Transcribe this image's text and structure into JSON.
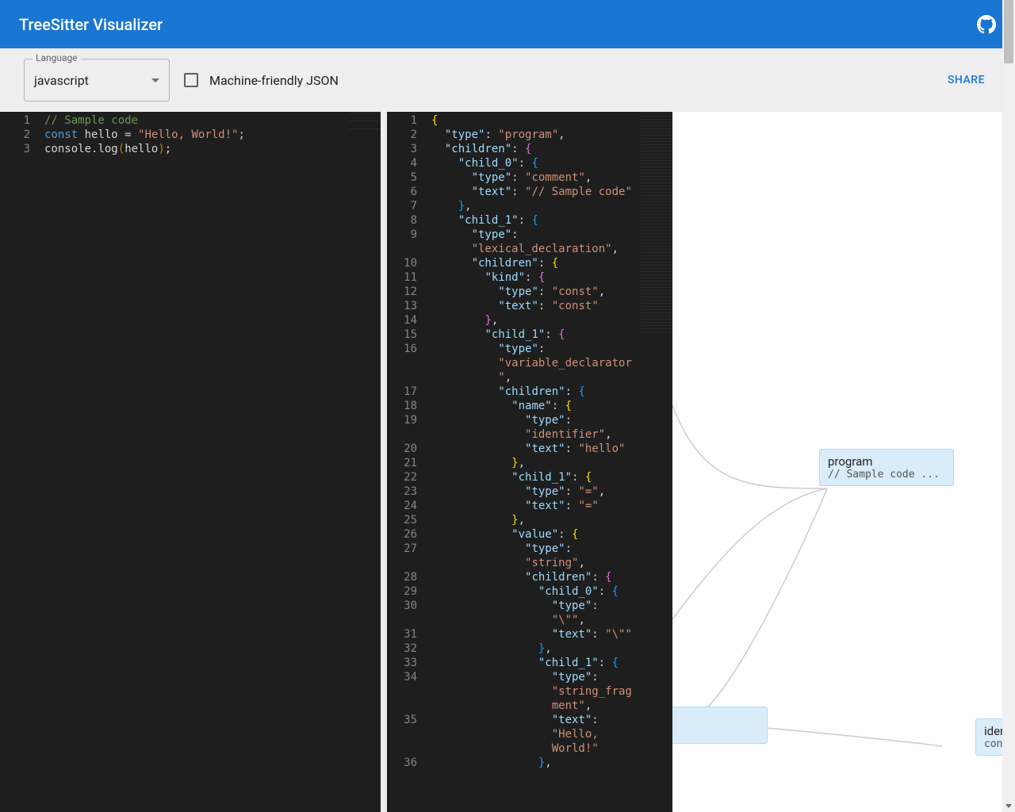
{
  "header": {
    "title": "TreeSitter Visualizer"
  },
  "toolbar": {
    "language_label": "Language",
    "language_value": "javascript",
    "checkbox_label": "Machine-friendly JSON",
    "share_label": "SHARE"
  },
  "source": {
    "lines": [
      [
        {
          "c": "tk-comment",
          "t": "// Sample code"
        }
      ],
      [
        {
          "c": "tk-kw",
          "t": "const"
        },
        {
          "c": "tk-id",
          "t": " hello "
        },
        {
          "c": "tk-punc",
          "t": "= "
        },
        {
          "c": "tk-str",
          "t": "\"Hello, World!\""
        },
        {
          "c": "tk-punc",
          "t": ";"
        }
      ],
      [
        {
          "c": "tk-id",
          "t": "console"
        },
        {
          "c": "tk-punc",
          "t": "."
        },
        {
          "c": "tk-id",
          "t": "log"
        },
        {
          "c": "tk-paren",
          "t": "("
        },
        {
          "c": "tk-id",
          "t": "hello"
        },
        {
          "c": "tk-paren",
          "t": ")"
        },
        {
          "c": "tk-punc",
          "t": ";"
        }
      ]
    ]
  },
  "json": {
    "lines": [
      {
        "i": 0,
        "seg": [
          {
            "c": "tk-brace3",
            "t": "{"
          }
        ]
      },
      {
        "i": 1,
        "seg": [
          {
            "c": "tk-key",
            "t": "\"type\""
          },
          {
            "c": "tk-punc",
            "t": ": "
          },
          {
            "c": "tk-str",
            "t": "\"program\""
          },
          {
            "c": "tk-punc",
            "t": ","
          }
        ]
      },
      {
        "i": 1,
        "seg": [
          {
            "c": "tk-key",
            "t": "\"children\""
          },
          {
            "c": "tk-punc",
            "t": ": "
          },
          {
            "c": "tk-brace",
            "t": "{"
          }
        ]
      },
      {
        "i": 2,
        "seg": [
          {
            "c": "tk-key",
            "t": "\"child_0\""
          },
          {
            "c": "tk-punc",
            "t": ": "
          },
          {
            "c": "tk-brace2",
            "t": "{"
          }
        ]
      },
      {
        "i": 3,
        "seg": [
          {
            "c": "tk-key",
            "t": "\"type\""
          },
          {
            "c": "tk-punc",
            "t": ": "
          },
          {
            "c": "tk-str",
            "t": "\"comment\""
          },
          {
            "c": "tk-punc",
            "t": ","
          }
        ]
      },
      {
        "i": 3,
        "seg": [
          {
            "c": "tk-key",
            "t": "\"text\""
          },
          {
            "c": "tk-punc",
            "t": ": "
          },
          {
            "c": "tk-str",
            "t": "\"// Sample code\""
          }
        ]
      },
      {
        "i": 2,
        "seg": [
          {
            "c": "tk-brace2",
            "t": "}"
          },
          {
            "c": "tk-punc",
            "t": ","
          }
        ]
      },
      {
        "i": 2,
        "seg": [
          {
            "c": "tk-key",
            "t": "\"child_1\""
          },
          {
            "c": "tk-punc",
            "t": ": "
          },
          {
            "c": "tk-brace2",
            "t": "{"
          }
        ]
      },
      {
        "i": 3,
        "seg": [
          {
            "c": "tk-key",
            "t": "\"type\""
          },
          {
            "c": "tk-punc",
            "t": ":"
          }
        ]
      },
      {
        "i": 3,
        "seg": [
          {
            "c": "tk-str",
            "t": "\"lexical_declaration\""
          },
          {
            "c": "tk-punc",
            "t": ","
          }
        ]
      },
      {
        "i": 3,
        "seg": [
          {
            "c": "tk-key",
            "t": "\"children\""
          },
          {
            "c": "tk-punc",
            "t": ": "
          },
          {
            "c": "tk-brace3",
            "t": "{"
          }
        ]
      },
      {
        "i": 4,
        "seg": [
          {
            "c": "tk-key",
            "t": "\"kind\""
          },
          {
            "c": "tk-punc",
            "t": ": "
          },
          {
            "c": "tk-brace",
            "t": "{"
          }
        ]
      },
      {
        "i": 5,
        "seg": [
          {
            "c": "tk-key",
            "t": "\"type\""
          },
          {
            "c": "tk-punc",
            "t": ": "
          },
          {
            "c": "tk-str",
            "t": "\"const\""
          },
          {
            "c": "tk-punc",
            "t": ","
          }
        ]
      },
      {
        "i": 5,
        "seg": [
          {
            "c": "tk-key",
            "t": "\"text\""
          },
          {
            "c": "tk-punc",
            "t": ": "
          },
          {
            "c": "tk-str",
            "t": "\"const\""
          }
        ]
      },
      {
        "i": 4,
        "seg": [
          {
            "c": "tk-brace",
            "t": "}"
          },
          {
            "c": "tk-punc",
            "t": ","
          }
        ]
      },
      {
        "i": 4,
        "seg": [
          {
            "c": "tk-key",
            "t": "\"child_1\""
          },
          {
            "c": "tk-punc",
            "t": ": "
          },
          {
            "c": "tk-brace",
            "t": "{"
          }
        ]
      },
      {
        "i": 5,
        "seg": [
          {
            "c": "tk-key",
            "t": "\"type\""
          },
          {
            "c": "tk-punc",
            "t": ":"
          }
        ]
      },
      {
        "i": 5,
        "seg": [
          {
            "c": "tk-str",
            "t": "\"variable_declarator"
          }
        ]
      },
      {
        "i": 5,
        "seg": [
          {
            "c": "tk-str",
            "t": "\""
          },
          {
            "c": "tk-punc",
            "t": ","
          }
        ]
      },
      {
        "i": 5,
        "seg": [
          {
            "c": "tk-key",
            "t": "\"children\""
          },
          {
            "c": "tk-punc",
            "t": ": "
          },
          {
            "c": "tk-brace2",
            "t": "{"
          }
        ]
      },
      {
        "i": 6,
        "seg": [
          {
            "c": "tk-key",
            "t": "\"name\""
          },
          {
            "c": "tk-punc",
            "t": ": "
          },
          {
            "c": "tk-brace3",
            "t": "{"
          }
        ]
      },
      {
        "i": 7,
        "seg": [
          {
            "c": "tk-key",
            "t": "\"type\""
          },
          {
            "c": "tk-punc",
            "t": ":"
          }
        ]
      },
      {
        "i": 7,
        "seg": [
          {
            "c": "tk-str",
            "t": "\"identifier\""
          },
          {
            "c": "tk-punc",
            "t": ","
          }
        ]
      },
      {
        "i": 7,
        "seg": [
          {
            "c": "tk-key",
            "t": "\"text\""
          },
          {
            "c": "tk-punc",
            "t": ": "
          },
          {
            "c": "tk-str",
            "t": "\"hello\""
          }
        ]
      },
      {
        "i": 6,
        "seg": [
          {
            "c": "tk-brace3",
            "t": "}"
          },
          {
            "c": "tk-punc",
            "t": ","
          }
        ]
      },
      {
        "i": 6,
        "seg": [
          {
            "c": "tk-key",
            "t": "\"child_1\""
          },
          {
            "c": "tk-punc",
            "t": ": "
          },
          {
            "c": "tk-brace3",
            "t": "{"
          }
        ]
      },
      {
        "i": 7,
        "seg": [
          {
            "c": "tk-key",
            "t": "\"type\""
          },
          {
            "c": "tk-punc",
            "t": ": "
          },
          {
            "c": "tk-str",
            "t": "\"=\""
          },
          {
            "c": "tk-punc",
            "t": ","
          }
        ]
      },
      {
        "i": 7,
        "seg": [
          {
            "c": "tk-key",
            "t": "\"text\""
          },
          {
            "c": "tk-punc",
            "t": ": "
          },
          {
            "c": "tk-str",
            "t": "\"=\""
          }
        ]
      },
      {
        "i": 6,
        "seg": [
          {
            "c": "tk-brace3",
            "t": "}"
          },
          {
            "c": "tk-punc",
            "t": ","
          }
        ]
      },
      {
        "i": 6,
        "seg": [
          {
            "c": "tk-key",
            "t": "\"value\""
          },
          {
            "c": "tk-punc",
            "t": ": "
          },
          {
            "c": "tk-brace3",
            "t": "{"
          }
        ]
      },
      {
        "i": 7,
        "seg": [
          {
            "c": "tk-key",
            "t": "\"type\""
          },
          {
            "c": "tk-punc",
            "t": ":"
          }
        ]
      },
      {
        "i": 7,
        "seg": [
          {
            "c": "tk-str",
            "t": "\"string\""
          },
          {
            "c": "tk-punc",
            "t": ","
          }
        ]
      },
      {
        "i": 7,
        "seg": [
          {
            "c": "tk-key",
            "t": "\"children\""
          },
          {
            "c": "tk-punc",
            "t": ": "
          },
          {
            "c": "tk-brace",
            "t": "{"
          }
        ]
      },
      {
        "i": 8,
        "seg": [
          {
            "c": "tk-key",
            "t": "\"child_0\""
          },
          {
            "c": "tk-punc",
            "t": ": "
          },
          {
            "c": "tk-brace2",
            "t": "{"
          }
        ]
      },
      {
        "i": 9,
        "seg": [
          {
            "c": "tk-key",
            "t": "\"type\""
          },
          {
            "c": "tk-punc",
            "t": ":"
          }
        ]
      },
      {
        "i": 9,
        "seg": [
          {
            "c": "tk-str",
            "t": "\"\\\"\""
          },
          {
            "c": "tk-punc",
            "t": ","
          }
        ]
      },
      {
        "i": 9,
        "seg": [
          {
            "c": "tk-key",
            "t": "\"text\""
          },
          {
            "c": "tk-punc",
            "t": ": "
          },
          {
            "c": "tk-str",
            "t": "\"\\\"\""
          }
        ]
      },
      {
        "i": 8,
        "seg": [
          {
            "c": "tk-brace2",
            "t": "}"
          },
          {
            "c": "tk-punc",
            "t": ","
          }
        ]
      },
      {
        "i": 8,
        "seg": [
          {
            "c": "tk-key",
            "t": "\"child_1\""
          },
          {
            "c": "tk-punc",
            "t": ": "
          },
          {
            "c": "tk-brace2",
            "t": "{"
          }
        ]
      },
      {
        "i": 9,
        "seg": [
          {
            "c": "tk-key",
            "t": "\"type\""
          },
          {
            "c": "tk-punc",
            "t": ":"
          }
        ]
      },
      {
        "i": 9,
        "seg": [
          {
            "c": "tk-str",
            "t": "\"string_frag"
          }
        ]
      },
      {
        "i": 9,
        "seg": [
          {
            "c": "tk-str",
            "t": "ment\""
          },
          {
            "c": "tk-punc",
            "t": ","
          }
        ]
      },
      {
        "i": 9,
        "seg": [
          {
            "c": "tk-key",
            "t": "\"text\""
          },
          {
            "c": "tk-punc",
            "t": ":"
          }
        ]
      },
      {
        "i": 9,
        "seg": [
          {
            "c": "tk-str",
            "t": "\"Hello,"
          }
        ]
      },
      {
        "i": 9,
        "seg": [
          {
            "c": "tk-str",
            "t": "World!\""
          }
        ]
      },
      {
        "i": 8,
        "seg": [
          {
            "c": "tk-brace2",
            "t": "}"
          },
          {
            "c": "tk-punc",
            "t": ","
          }
        ]
      }
    ],
    "wrapped_line_numbers": [
      1,
      2,
      3,
      4,
      5,
      6,
      7,
      8,
      9,
      "",
      10,
      11,
      12,
      13,
      14,
      15,
      16,
      "",
      "",
      17,
      18,
      19,
      "",
      20,
      21,
      22,
      23,
      24,
      25,
      26,
      27,
      "",
      28,
      29,
      30,
      "",
      31,
      32,
      33,
      34,
      "",
      "",
      35,
      "",
      "",
      36
    ]
  },
  "tree": {
    "root": {
      "title": "program",
      "text": "// Sample code ..."
    },
    "leaf1": {
      "title": "identi",
      "text": "conso"
    }
  }
}
